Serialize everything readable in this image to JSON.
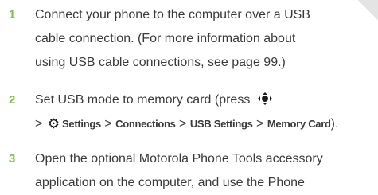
{
  "steps": [
    {
      "number": "1",
      "lines": [
        "Connect your phone to the computer over a USB",
        "cable connection. (For more information about",
        "using USB cable connections, see page 99.)"
      ]
    },
    {
      "number": "2",
      "line1": "Set USB mode to memory card (press",
      "line2_prefix": "> ",
      "line2_suffix": ").",
      "separator": " > ",
      "menu_path": [
        "Settings",
        "Connections",
        "USB Settings",
        "Memory Card"
      ]
    },
    {
      "number": "3",
      "lines": [
        "Open the optional Motorola Phone Tools accessory",
        "application on the computer, and use the Phone"
      ]
    }
  ],
  "icons": {
    "nav_key": "nav-key-icon",
    "settings": "settings-gear-icon"
  },
  "colors": {
    "step_number": "#7bbf45",
    "text": "#3a3a3a",
    "menu_text": "#1a1a1a"
  }
}
